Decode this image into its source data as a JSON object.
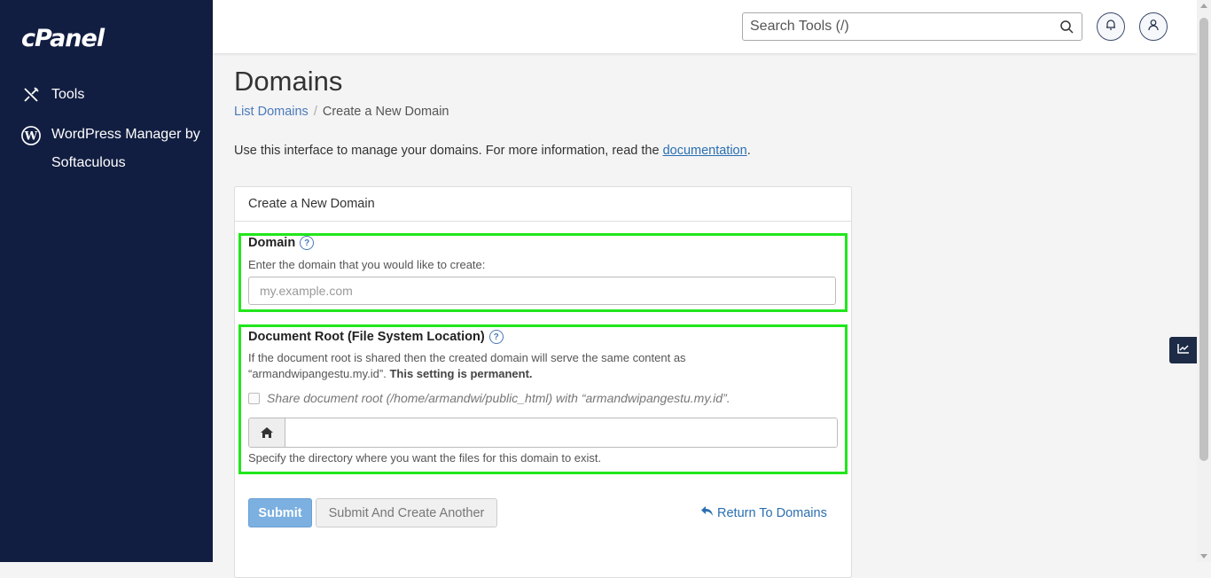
{
  "brand": {
    "logo_text": "cPanel"
  },
  "sidebar": {
    "items": [
      {
        "label": "Tools",
        "icon": "tools-icon"
      },
      {
        "label": "WordPress Manager by Softaculous",
        "icon": "wordpress-icon"
      }
    ]
  },
  "header": {
    "search_placeholder": "Search Tools (/)",
    "search_icon": "search-icon",
    "notifications_icon": "bell-icon",
    "user_icon": "user-icon"
  },
  "page": {
    "title": "Domains",
    "breadcrumb": [
      "List Domains",
      "Create a New Domain"
    ],
    "breadcrumb_separator": "/",
    "intro_text": "Use this interface to manage your domains. For more information, read the ",
    "intro_link": "documentation",
    "intro_end": "."
  },
  "form": {
    "panel_title": "Create a New Domain",
    "domain_label": "Domain",
    "domain_hint": "Enter the domain that you would like to create:",
    "domain_placeholder": "my.example.com",
    "docroot_label": "Document Root (File System Location)",
    "docroot_desc": "If the document root is shared then the created domain will serve the same content as “armandwipangestu.my.id”.",
    "docroot_permanent": "This setting is permanent.",
    "share_label": "Share document root (/home/armandwi/public_html) with “armandwipangestu.my.id”.",
    "docroot_value": "",
    "docroot_spec": "Specify the directory where you want the files for this domain to exist.",
    "submit_label": "Submit",
    "submit_another_label": "Submit And Create Another",
    "return_label": "Return To Domains"
  },
  "colors": {
    "sidebar_bg": "#121e41",
    "highlight": "#22e61c",
    "link": "#2a6fb0",
    "primary_btn": "#7cb0e0"
  }
}
